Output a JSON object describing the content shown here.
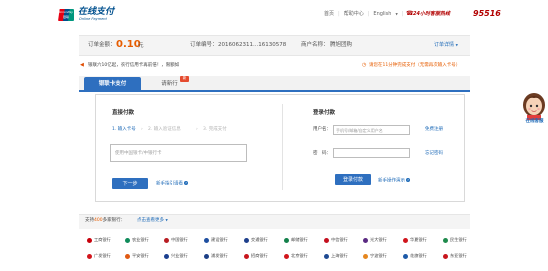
{
  "header": {
    "logo_top": "UnionPay",
    "logo_bottom": "银联",
    "brand_cn": "在线支付",
    "brand_en": "Online Payment",
    "nav": [
      "首页",
      "帮助中心",
      "English"
    ],
    "hotline_label": "24小时客服热线",
    "hotline_number": "95516"
  },
  "order": {
    "amount_label": "订单金额：",
    "amount": "0.10",
    "amount_unit": "元",
    "number_label": "订单编号：",
    "number": "2016062311...16130578",
    "merchant_label": "商户名称：",
    "merchant": "腾旭团购",
    "detail_link": "订单详情"
  },
  "notice": {
    "left": "银联六10亿起，农行信用卡再前倍！，限额如",
    "right": "请您在11分钟完成支付（无需再次输入卡号）"
  },
  "tabs": {
    "debit": "银联卡支付",
    "credit": "请新行",
    "badge": "新"
  },
  "direct": {
    "title": "直接付款",
    "steps": [
      "1. 输入卡号",
      "2. 输入验证信息",
      "3. 完成支付"
    ],
    "card_placeholder": "使用中国银卡/中银行卡",
    "next_button": "下一步",
    "guide_link": "新手指引请看"
  },
  "login": {
    "title": "登录付款",
    "user_label": "用户名：",
    "user_placeholder": "手机号/邮箱/自定义用户名",
    "register_link": "免费注册",
    "pwd_label": "密　码：",
    "forgot_link": "忘记密码",
    "login_button": "登录付款",
    "guide_link": "新手操作演示"
  },
  "assistant": {
    "label": "在线客服"
  },
  "banks": {
    "title_prefix": "支持",
    "count": "400",
    "title_suffix": "多家银行：",
    "more_link": "点击查看更多",
    "items": [
      {
        "name": "工商银行",
        "color": "#c7000b"
      },
      {
        "name": "农业银行",
        "color": "#0f8b5a"
      },
      {
        "name": "中国银行",
        "color": "#b81c22"
      },
      {
        "name": "建设银行",
        "color": "#1e4fa0"
      },
      {
        "name": "交通银行",
        "color": "#1e3f8c"
      },
      {
        "name": "邮储银行",
        "color": "#13804a"
      },
      {
        "name": "中信银行",
        "color": "#c40f1e"
      },
      {
        "name": "光大银行",
        "color": "#5a2a82"
      },
      {
        "name": "华夏银行",
        "color": "#d0151c"
      },
      {
        "name": "民生银行",
        "color": "#1f8a4c"
      },
      {
        "name": "广发银行",
        "color": "#d2151c"
      },
      {
        "name": "平安银行",
        "color": "#e05a13"
      },
      {
        "name": "兴业银行",
        "color": "#1b3f8f"
      },
      {
        "name": "浦发银行",
        "color": "#1c3f86"
      },
      {
        "name": "招商银行",
        "color": "#c8161d"
      },
      {
        "name": "北京银行",
        "color": "#d1161c"
      },
      {
        "name": "上海银行",
        "color": "#1e4a92"
      },
      {
        "name": "宁波银行",
        "color": "#e5871f"
      },
      {
        "name": "花旗银行",
        "color": "#1d5aa8"
      },
      {
        "name": "东亚银行",
        "color": "#c8161d"
      }
    ]
  }
}
